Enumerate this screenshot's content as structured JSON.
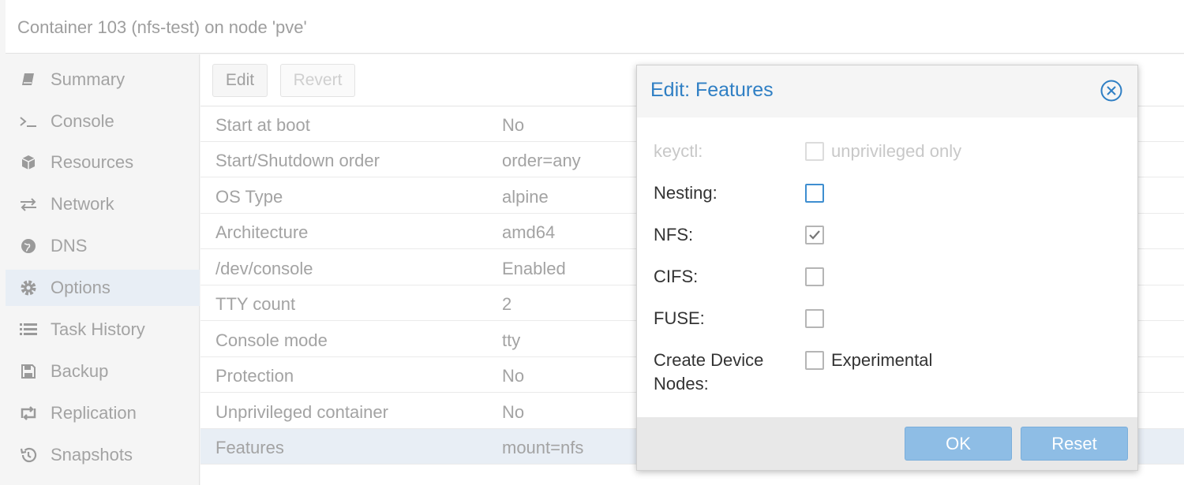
{
  "window": {
    "title": "Container 103 (nfs-test) on node 'pve'"
  },
  "sidebar": {
    "items": [
      {
        "label": "Summary",
        "icon": "book-icon"
      },
      {
        "label": "Console",
        "icon": "terminal-icon"
      },
      {
        "label": "Resources",
        "icon": "cube-icon"
      },
      {
        "label": "Network",
        "icon": "exchange-icon"
      },
      {
        "label": "DNS",
        "icon": "globe-icon"
      },
      {
        "label": "Options",
        "icon": "gear-icon",
        "selected": true
      },
      {
        "label": "Task History",
        "icon": "list-icon"
      },
      {
        "label": "Backup",
        "icon": "floppy-icon"
      },
      {
        "label": "Replication",
        "icon": "retweet-icon"
      },
      {
        "label": "Snapshots",
        "icon": "history-icon"
      }
    ]
  },
  "toolbar": {
    "edit_label": "Edit",
    "revert_label": "Revert"
  },
  "options": {
    "rows": [
      {
        "name": "Start at boot",
        "value": "No"
      },
      {
        "name": "Start/Shutdown order",
        "value": "order=any"
      },
      {
        "name": "OS Type",
        "value": "alpine"
      },
      {
        "name": "Architecture",
        "value": "amd64"
      },
      {
        "name": "/dev/console",
        "value": "Enabled"
      },
      {
        "name": "TTY count",
        "value": "2"
      },
      {
        "name": "Console mode",
        "value": "tty"
      },
      {
        "name": "Protection",
        "value": "No"
      },
      {
        "name": "Unprivileged container",
        "value": "No"
      },
      {
        "name": "Features",
        "value": "mount=nfs",
        "selected": true
      }
    ]
  },
  "dialog": {
    "title": "Edit: Features",
    "fields": {
      "keyctl": {
        "label": "keyctl:",
        "checked": false,
        "disabled": true,
        "text": "unprivileged only"
      },
      "nesting": {
        "label": "Nesting:",
        "checked": false
      },
      "nfs": {
        "label": "NFS:",
        "checked": true
      },
      "cifs": {
        "label": "CIFS:",
        "checked": false
      },
      "fuse": {
        "label": "FUSE:",
        "checked": false
      },
      "mknod": {
        "label_line1": "Create Device",
        "label_line2": "Nodes:",
        "checked": false,
        "text": "Experimental"
      }
    },
    "ok_label": "OK",
    "reset_label": "Reset"
  },
  "colors": {
    "accent": "#2f7fc4",
    "button": "#8ebde5",
    "selection": "#e8eef5"
  }
}
